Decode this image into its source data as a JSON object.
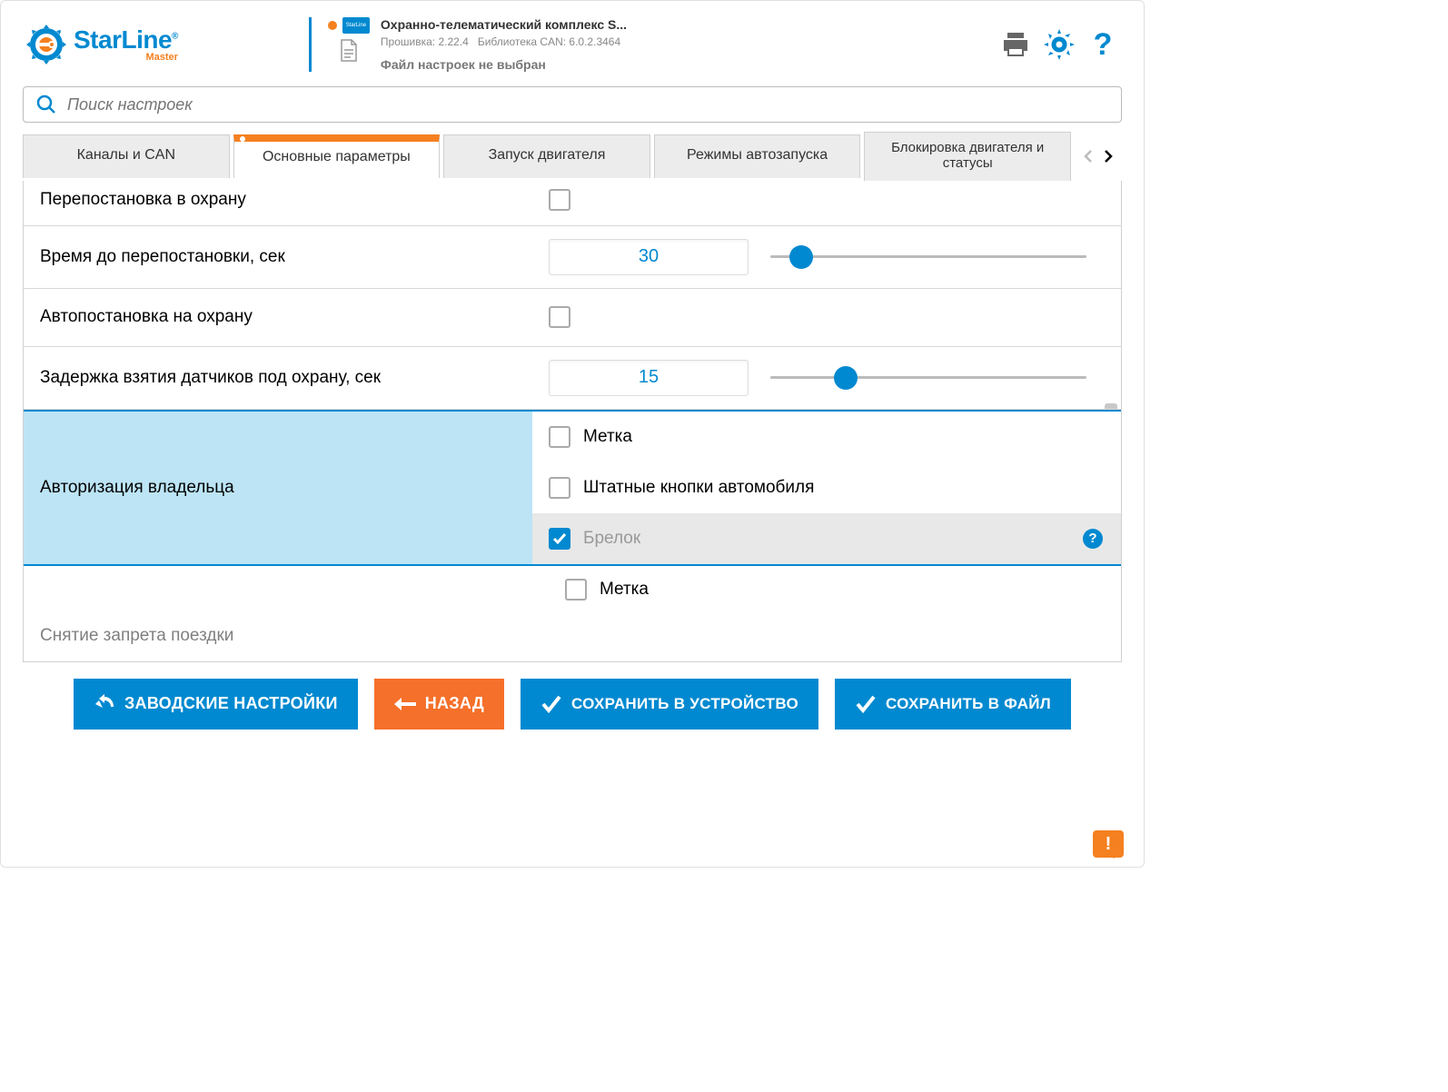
{
  "logo": {
    "brand": "StarLine",
    "sub": "Master",
    "badge": "StarLine"
  },
  "device": {
    "title": "Охранно-телематический комплекс S...",
    "firmware_label": "Прошивка: 2.22.4",
    "canlib_label": "Библиотека CAN: 6.0.2.3464",
    "file_status": "Файл настроек не выбран"
  },
  "search": {
    "placeholder": "Поиск настроек"
  },
  "tabs": {
    "t1": "Каналы и CAN",
    "t2": "Основные параметры",
    "t3": "Запуск двигателя",
    "t4": "Режимы автозапуска",
    "t5": "Блокировка двигателя и статусы"
  },
  "settings": {
    "r1": "Перепостановка в охрану",
    "r2": "Время до перепостановки, сек",
    "r2_val": "30",
    "r3": "Автопостановка на охрану",
    "r4": "Задержка взятия датчиков под охрану, сек",
    "r4_val": "15",
    "r5": "Авторизация владельца",
    "r5_opt1": "Метка",
    "r5_opt2": "Штатные кнопки автомобиля",
    "r5_opt3": "Брелок",
    "r6_opt1": "Метка",
    "r7": "Снятие запрета поездки"
  },
  "footer": {
    "factory": "ЗАВОДСКИЕ НАСТРОЙКИ",
    "back": "НАЗАД",
    "save_device": "СОХРАНИТЬ В УСТРОЙСТВО",
    "save_file": "СОХРАНИТЬ В ФАЙЛ"
  },
  "notif": "!"
}
